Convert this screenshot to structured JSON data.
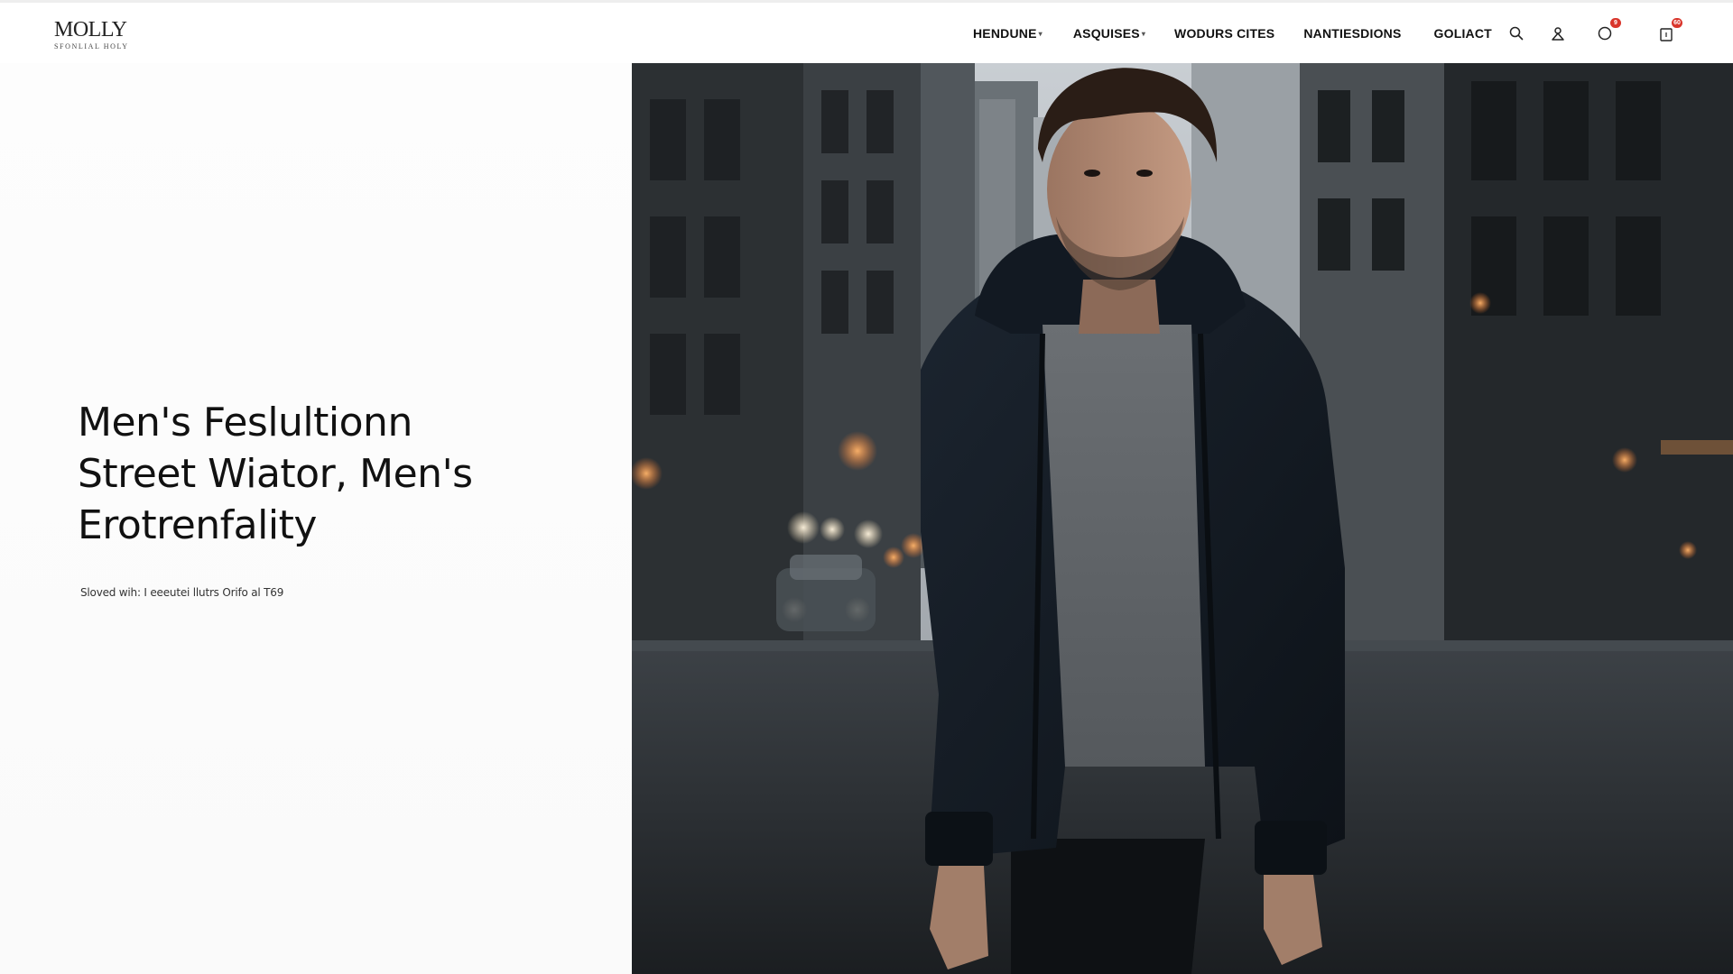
{
  "brand": {
    "name": "MOLLY",
    "tagline": "SFONLIAL HOLY"
  },
  "nav": {
    "items": [
      {
        "label": "HENDUNE",
        "caret": true
      },
      {
        "label": "ASQUISES",
        "caret": true
      },
      {
        "label": "WODURS CITES",
        "caret": false
      },
      {
        "label": "NANTIESDIONS",
        "caret": false
      },
      {
        "label": "GOLIACT",
        "caret": false
      }
    ]
  },
  "header_icons": {
    "search": "search-icon",
    "account": "user-icon",
    "wishlist": "heart-icon",
    "wishlist_badge": "9",
    "cart": "bag-icon",
    "cart_badge": "60"
  },
  "hero": {
    "title_lines": [
      "Men's Feslultionn",
      "Street Wiator, Men's",
      "Erotrenfality"
    ],
    "subtitle": "Sloved wih: I eeeutei llutrs Orifo al T69"
  },
  "colors": {
    "badge": "#d9352b",
    "text": "#111111",
    "background": "#ffffff"
  }
}
